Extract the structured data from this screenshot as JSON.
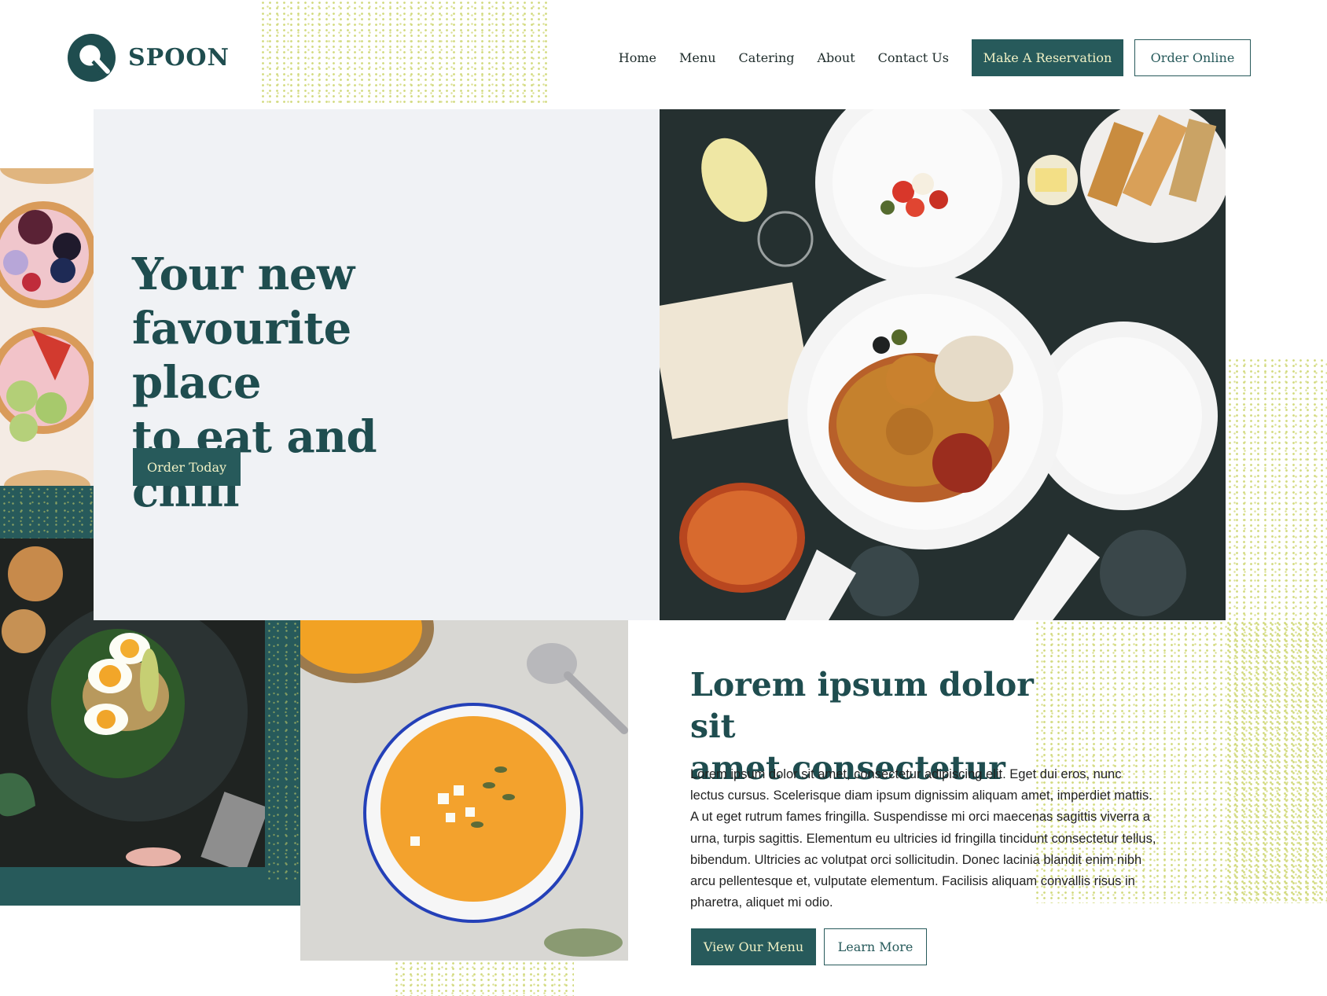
{
  "brand": {
    "name": "SPOON"
  },
  "nav": {
    "links": [
      "Home",
      "Menu",
      "Catering",
      "About",
      "Contact Us"
    ],
    "reservation_label": "Make A Reservation",
    "order_online_label": "Order Online"
  },
  "hero": {
    "title": "Your new\nfavourite place\nto eat and chill",
    "cta_label": "Order Today"
  },
  "about": {
    "title": "Lorem ipsum dolor sit\namet consectetur",
    "body": "Lorem ipsum dolor sit amet, consectetur adipiscing elit. Eget dui eros, nunc lectus cursus. Scelerisque diam ipsum dignissim aliquam amet, imperdiet mattis. A ut eget rutrum fames fringilla. Suspendisse mi orci maecenas sagittis viverra a urna, turpis sagittis. Elementum eu ultricies id fringilla tincidunt consectetur tellus, bibendum. Ultricies ac volutpat orci sollicitudin. Donec lacinia blandit enim nibh arcu pellentesque et, vulputate elementum. Facilisis aliquam convallis risus in pharetra, aliquet mi odio.",
    "view_menu_label": "View Our Menu",
    "learn_more_label": "Learn More"
  },
  "colors": {
    "brand_green": "#275a5b",
    "button_text": "#f0f1c5",
    "speckle": "#cbd46a",
    "hero_panel": "#f0f2f5"
  }
}
